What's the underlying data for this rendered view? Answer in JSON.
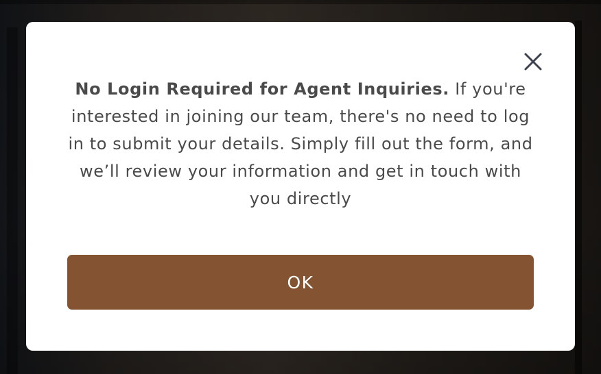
{
  "modal": {
    "heading": "No Login Required for Agent Inquiries.",
    "body": " If you're interested in joining our team, there's no need to log in to submit your details. Simply fill out the form, and we’ll review your information and get in touch with you directly",
    "ok_label": "OK",
    "close_icon": "close-icon"
  },
  "colors": {
    "button": "#845331",
    "text": "#4a4a4a",
    "close_icon": "#3d4250"
  }
}
